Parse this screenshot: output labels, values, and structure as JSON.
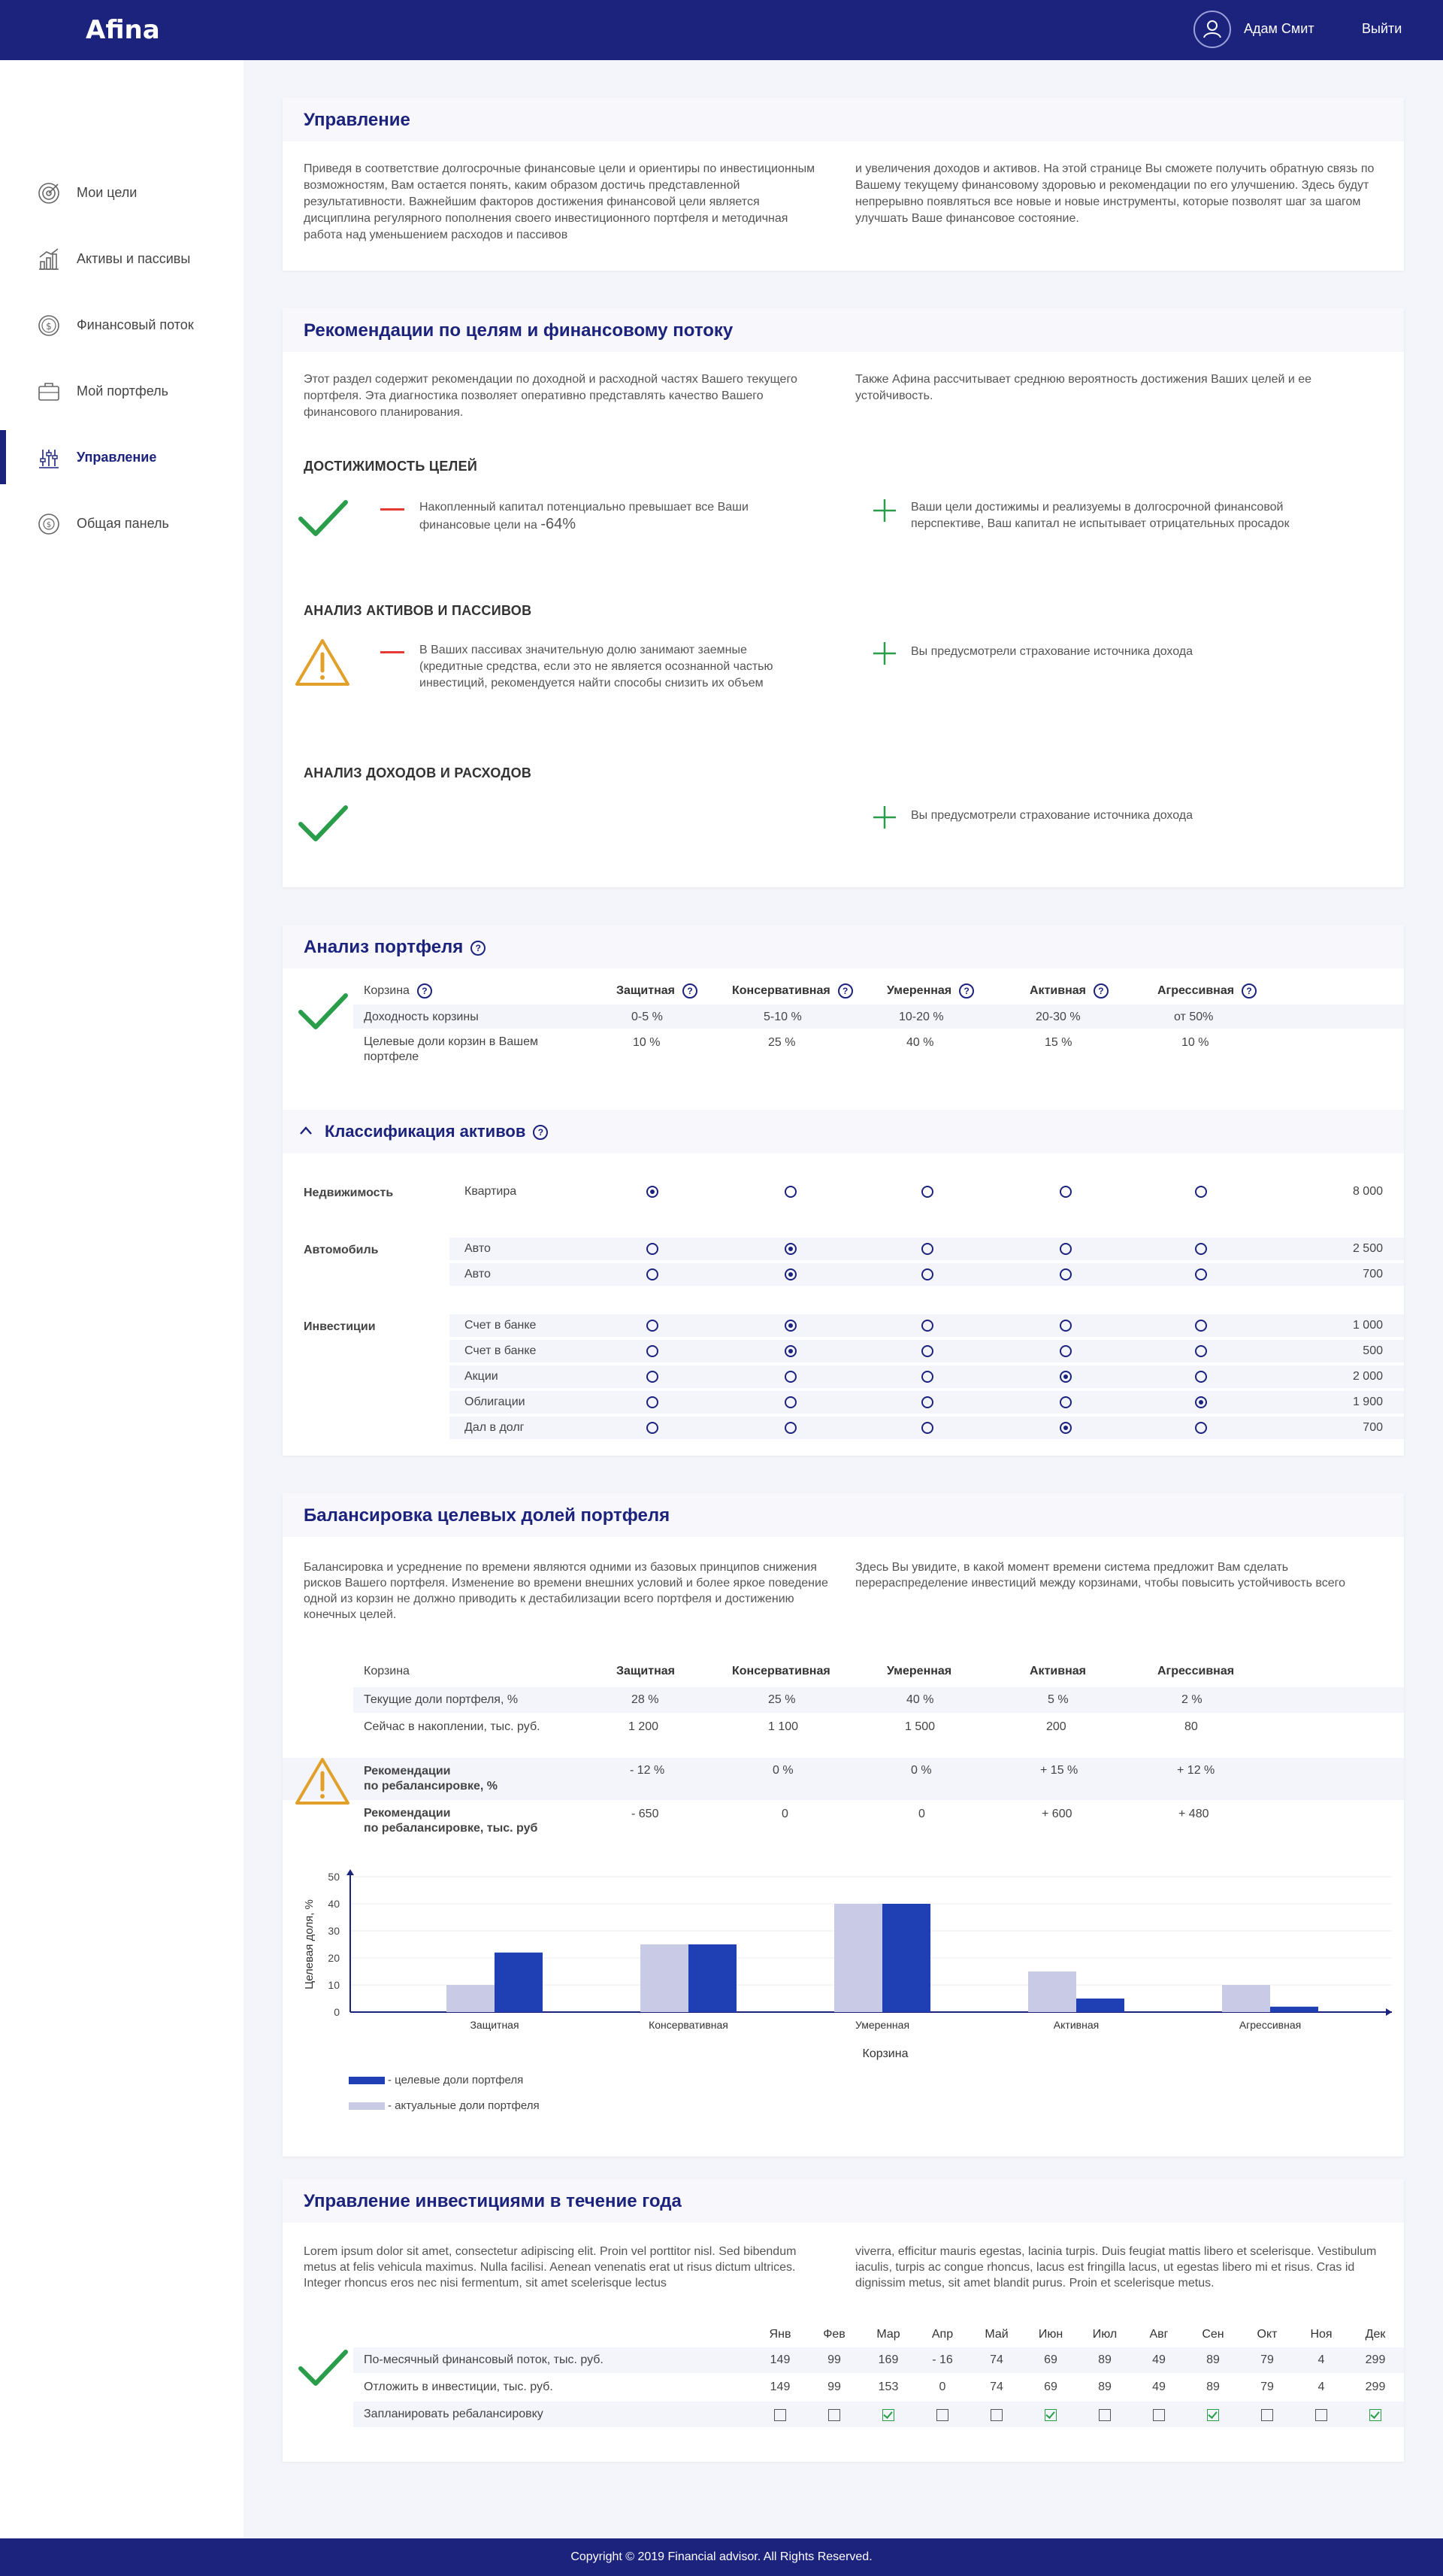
{
  "header": {
    "logo": "Afina",
    "user_name": "Адам Смит",
    "logout": "Выйти"
  },
  "sidebar": {
    "items": [
      {
        "label": "Мои цели",
        "icon": "target-icon"
      },
      {
        "label": "Активы и пассивы",
        "icon": "growth-chart-icon"
      },
      {
        "label": "Финансовый поток",
        "icon": "coin-icon"
      },
      {
        "label": "Мой портфель",
        "icon": "briefcase-icon"
      },
      {
        "label": "Управление",
        "icon": "sliders-icon"
      },
      {
        "label": "Общая панель",
        "icon": "dashboard-icon"
      }
    ],
    "active": "Управление"
  },
  "management": {
    "title": "Управление",
    "text_left": "Приведя в соответствие долгосрочные финансовые цели и ориентиры по инвестиционным возможностям, Вам остается понять, каким образом достичь представленной результативности. Важнейшим факторов достижения финансовой цели является дисциплина регулярного пополнения своего инвестиционного портфеля и методичная работа над уменьшением расходов и пассивов",
    "text_right": "и увеличения доходов и активов. На этой странице Вы сможете получить обратную связь по Вашему текущему финансовому здоровью и рекомендации по его улучшению. Здесь будут непрерывно появляться все новые и новые инструменты, которые позволят шаг за шагом улучшать  Ваше финансовое состояние."
  },
  "recommendations": {
    "title": "Рекомендации по целям и финансовому потоку",
    "text_left": "Этот раздел содержит рекомендации по доходной и расходной частях Вашего текущего портфеля. Эта диагностика позволяет оперативно представлять качество Вашего финансового планирования.",
    "text_right": "Также Афина рассчитывает среднюю вероятность достижения Ваших целей и ее устойчивость.",
    "sections": [
      {
        "title": "ДОСТИЖИМОСТЬ ЦЕЛЕЙ",
        "status": "ok",
        "minus": "Накопленный капитал потенциально превышает все Ваши финансовые цели на",
        "minus_value": "-64%",
        "plus": "Ваши цели достижимы и реализуемы в долгосрочной финансовой перспективе, Ваш капитал не испытывает отрицательных просадок"
      },
      {
        "title": "АНАЛИЗ АКТИВОВ И ПАССИВОВ",
        "status": "warning",
        "minus": "В Ваших пассивах значительную долю занимают заемные (кредитные средства, если это не является осознанной частью инвестиций, рекомендуется найти способы снизить их объем",
        "plus": "Вы предусмотрели страхование источника дохода"
      },
      {
        "title": "АНАЛИЗ ДОХОДОВ И РАСХОДОВ",
        "status": "ok",
        "plus": "Вы предусмотрели страхование источника дохода"
      }
    ]
  },
  "portfolio": {
    "title": "Анализ портфеля",
    "headers": [
      "Корзина",
      "Защитная",
      "Консервативная",
      "Умеренная",
      "Активная",
      "Агрессивная"
    ],
    "rows": [
      {
        "label": "Доходность корзины",
        "values": [
          "0-5 %",
          "5-10 %",
          "10-20 %",
          "20-30 %",
          "от 50%"
        ]
      },
      {
        "label": "Целевые доли корзин в Вашем портфеле",
        "values": [
          "10 %",
          "25 %",
          "40 %",
          "15 %",
          "10 %"
        ]
      }
    ],
    "classification_title": "Классификация активов",
    "groups": [
      {
        "name": "Недвижимость",
        "items": [
          {
            "label": "Квартира",
            "sel": 0,
            "value": "8 000"
          }
        ]
      },
      {
        "name": "Автомобиль",
        "items": [
          {
            "label": "Авто",
            "sel": 1,
            "value": "2 500"
          },
          {
            "label": "Авто",
            "sel": 1,
            "value": "700"
          }
        ]
      },
      {
        "name": "Инвестиции",
        "items": [
          {
            "label": "Счет в банке",
            "sel": 1,
            "value": "1 000"
          },
          {
            "label": "Счет в банке",
            "sel": 1,
            "value": "500"
          },
          {
            "label": "Акции",
            "sel": 3,
            "value": "2 000"
          },
          {
            "label": "Облигации",
            "sel": 4,
            "value": "1 900"
          },
          {
            "label": "Дал в долг",
            "sel": 3,
            "value": "700"
          }
        ]
      }
    ]
  },
  "balancing": {
    "title": "Балансировка целевых долей портфеля",
    "text_left": "Балансировка  и усреднение по времени являются  одними из базовых принципов снижения рисков Вашего портфеля. Изменение во времени внешних условий и более яркое поведение одной из корзин не должно приводить к дестабилизации всего портфеля и достижению конечных целей.",
    "text_right": "Здесь Вы увидите, в какой момент времени система предложит Вам сделать перераспределение инвестиций между корзинами, чтобы повысить устойчивость всего",
    "headers": [
      "Корзина",
      "Защитная",
      "Консервативная",
      "Умеренная",
      "Активная",
      "Агрессивная"
    ],
    "rows": [
      {
        "label": "Текущие доли портфеля, %",
        "values": [
          "28 %",
          "25 %",
          "40 %",
          "5 %",
          "2 %"
        ]
      },
      {
        "label": "Сейчас в накоплении, тыс. руб.",
        "values": [
          "1 200",
          "1 100",
          "1 500",
          "200",
          "80"
        ]
      }
    ],
    "rec_rows": [
      {
        "label": "Рекомендации по ребалансировке, %",
        "line1": "Рекомендации",
        "line2": "по ребалансировке, %",
        "values": [
          "- 12 %",
          "0 %",
          "0 %",
          "+ 15 %",
          "+ 12 %"
        ]
      },
      {
        "label": "Рекомендации по ребалансировке, тыс. руб",
        "line1": "Рекомендации",
        "line2": "по ребалансировке, тыс. руб",
        "values": [
          "- 650",
          "0",
          "0",
          "+ 600",
          "+ 480"
        ]
      }
    ],
    "legend_target": "- целевые доли портфеля",
    "legend_actual": "- актуальные доли портфеля",
    "colors": {
      "target": "#1f3fb5",
      "actual": "#c8cae6"
    }
  },
  "chart_data": {
    "type": "bar",
    "categories": [
      "Защитная",
      "Консервативная",
      "Умеренная",
      "Активная",
      "Агрессивная"
    ],
    "series": [
      {
        "name": "актуальные доли портфеля",
        "values": [
          10,
          25,
          40,
          15,
          10
        ]
      },
      {
        "name": "целевые доли портфеля",
        "values": [
          22,
          25,
          40,
          5,
          2
        ]
      }
    ],
    "xlabel": "Корзина",
    "ylabel": "Целевая доля, %",
    "yticks": [
      "0",
      "10",
      "20",
      "30",
      "40",
      "50"
    ],
    "ylim": [
      0,
      50
    ],
    "grid": true,
    "legend": "bottom-left"
  },
  "yearly": {
    "title": "Управление инвестициями в течение года",
    "text_left": "Lorem ipsum dolor sit amet, consectetur adipiscing elit. Proin vel porttitor nisl. Sed bibendum metus at felis vehicula maximus. Nulla facilisi. Aenean venenatis erat ut risus dictum ultrices. Integer rhoncus eros nec nisi fermentum, sit amet scelerisque lectus",
    "text_right": "viverra, efficitur mauris egestas, lacinia turpis. Duis feugiat mattis libero et scelerisque. Vestibulum iaculis, turpis ac congue rhoncus, lacus est fringilla lacus, ut egestas libero mi et risus. Cras id dignissim metus, sit amet blandit purus. Proin et scelerisque metus.",
    "months": [
      "Янв",
      "Фев",
      "Мар",
      "Апр",
      "Май",
      "Июн",
      "Июл",
      "Авг",
      "Сен",
      "Окт",
      "Ноя",
      "Дек"
    ],
    "rows": [
      {
        "label": "По-месячный финансовый поток, тыс. руб.",
        "values": [
          "149",
          "99",
          "169",
          "- 16",
          "74",
          "69",
          "89",
          "49",
          "89",
          "79",
          "4",
          "299"
        ]
      },
      {
        "label": "Отложить в инвестиции, тыс. руб.",
        "values": [
          "149",
          "99",
          "153",
          "0",
          "74",
          "69",
          "89",
          "49",
          "89",
          "79",
          "4",
          "299"
        ]
      }
    ],
    "plan_label": "Запланировать ребалансировку",
    "plan_checks": [
      false,
      false,
      true,
      false,
      false,
      true,
      false,
      false,
      true,
      false,
      false,
      true
    ]
  },
  "footer": {
    "text": "Copyright © 2019 Financial advisor. All Rights Reserved."
  }
}
